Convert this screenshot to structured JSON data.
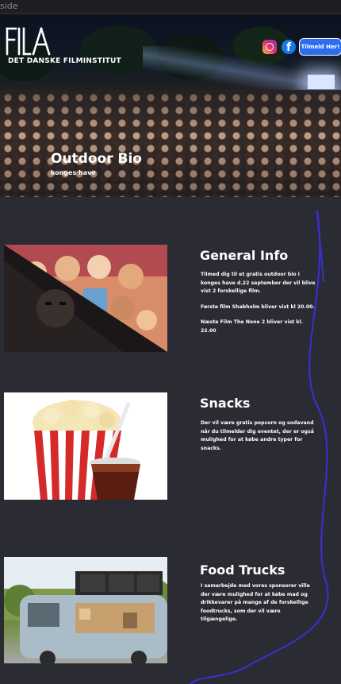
{
  "browser": {
    "tab_fragment": "side"
  },
  "header": {
    "logo_text": "DET DANSKE FILMINSTITUT",
    "signup_label": "Tilmeld Her!",
    "social_icons": [
      "instagram-icon",
      "facebook-icon"
    ]
  },
  "hero": {
    "title": "Outdoor Bio",
    "subtitle": "konges have"
  },
  "sections": [
    {
      "title": "General Info",
      "paragraphs": [
        "Tilmed dig til et gratis outdoor bio i konges have d.22 september der vil blive vist 2 forskellige film.",
        "Første film Shabholm bliver vist kl 20.00.",
        "Næste Film The None 2 bliver vist kl. 22.00"
      ]
    },
    {
      "title": "Snacks",
      "paragraphs": [
        "Der vil være gratis popcorn og sodavand når du tilmelder dig eventet, der er også mulighed for at købe andre typer for snacks."
      ]
    },
    {
      "title": "Food Trucks",
      "paragraphs": [
        "I samarbejde med vores sponsorer ville der være mulighed for at købe mad og drikkevarer på mange af de forskellige foodtrucks, som der vil være tilgængelige."
      ]
    }
  ],
  "colors": {
    "background": "#2b2c33",
    "accent_button": "#2a6df0",
    "swirl_line": "#3a2fd6"
  }
}
